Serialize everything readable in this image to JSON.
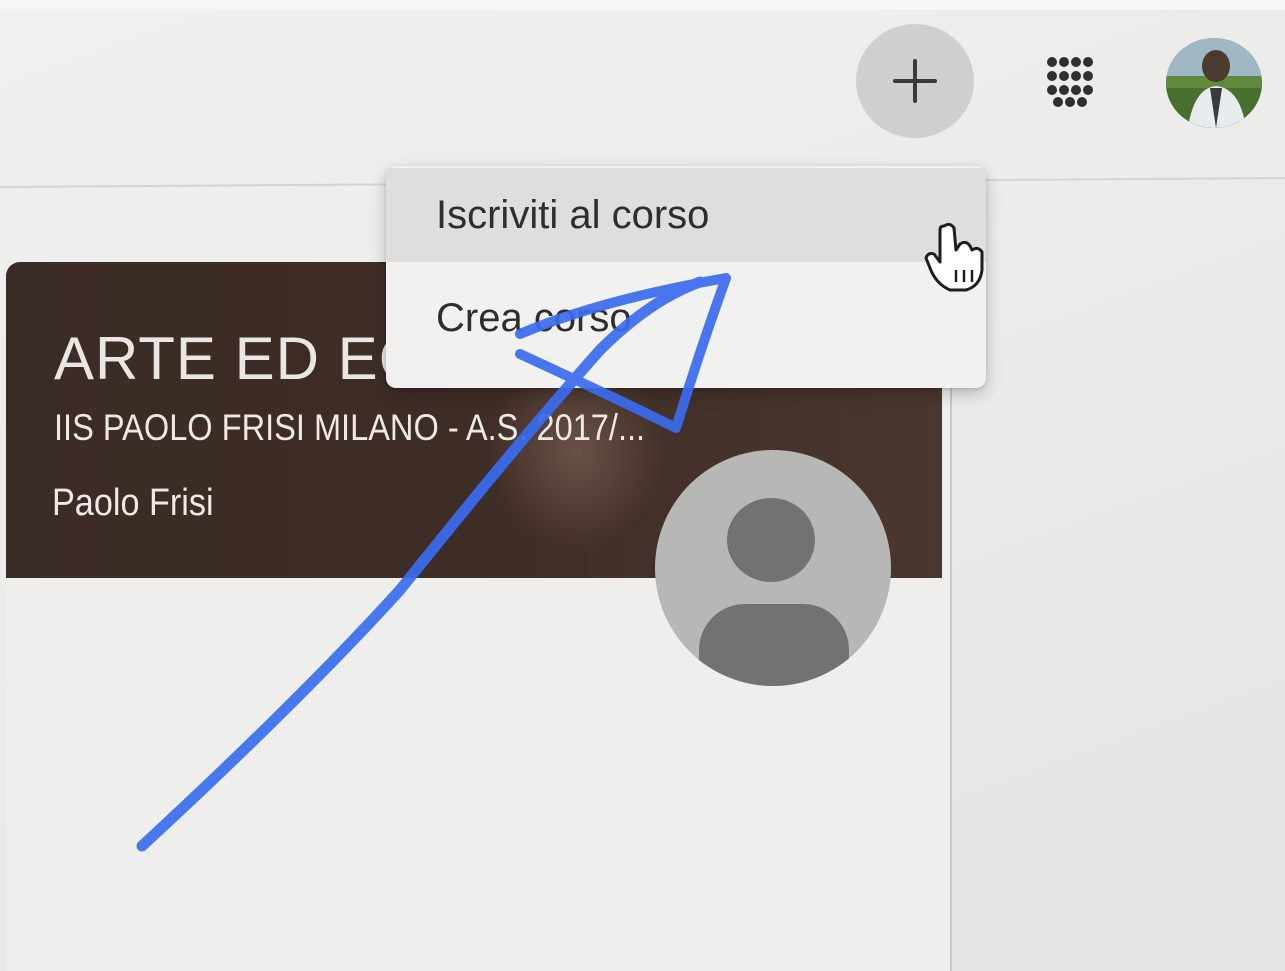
{
  "header": {
    "add_icon": "plus-icon",
    "apps_icon": "apps-grid-icon",
    "avatar_icon": "user-photo-avatar"
  },
  "menu": {
    "items": [
      {
        "label": "Iscriviti al corso"
      },
      {
        "label": "Crea corso"
      }
    ]
  },
  "course": {
    "title": "ARTE ED EC",
    "section": "IIS PAOLO FRISI MILANO - A.S. 2017/...",
    "teacher": "Paolo Frisi",
    "teacher_avatar_icon": "default-user-icon"
  },
  "colors": {
    "card_banner": "#3f2d27",
    "annotation_stroke": "#3a6cf0",
    "menu_hover": "#dededc"
  }
}
